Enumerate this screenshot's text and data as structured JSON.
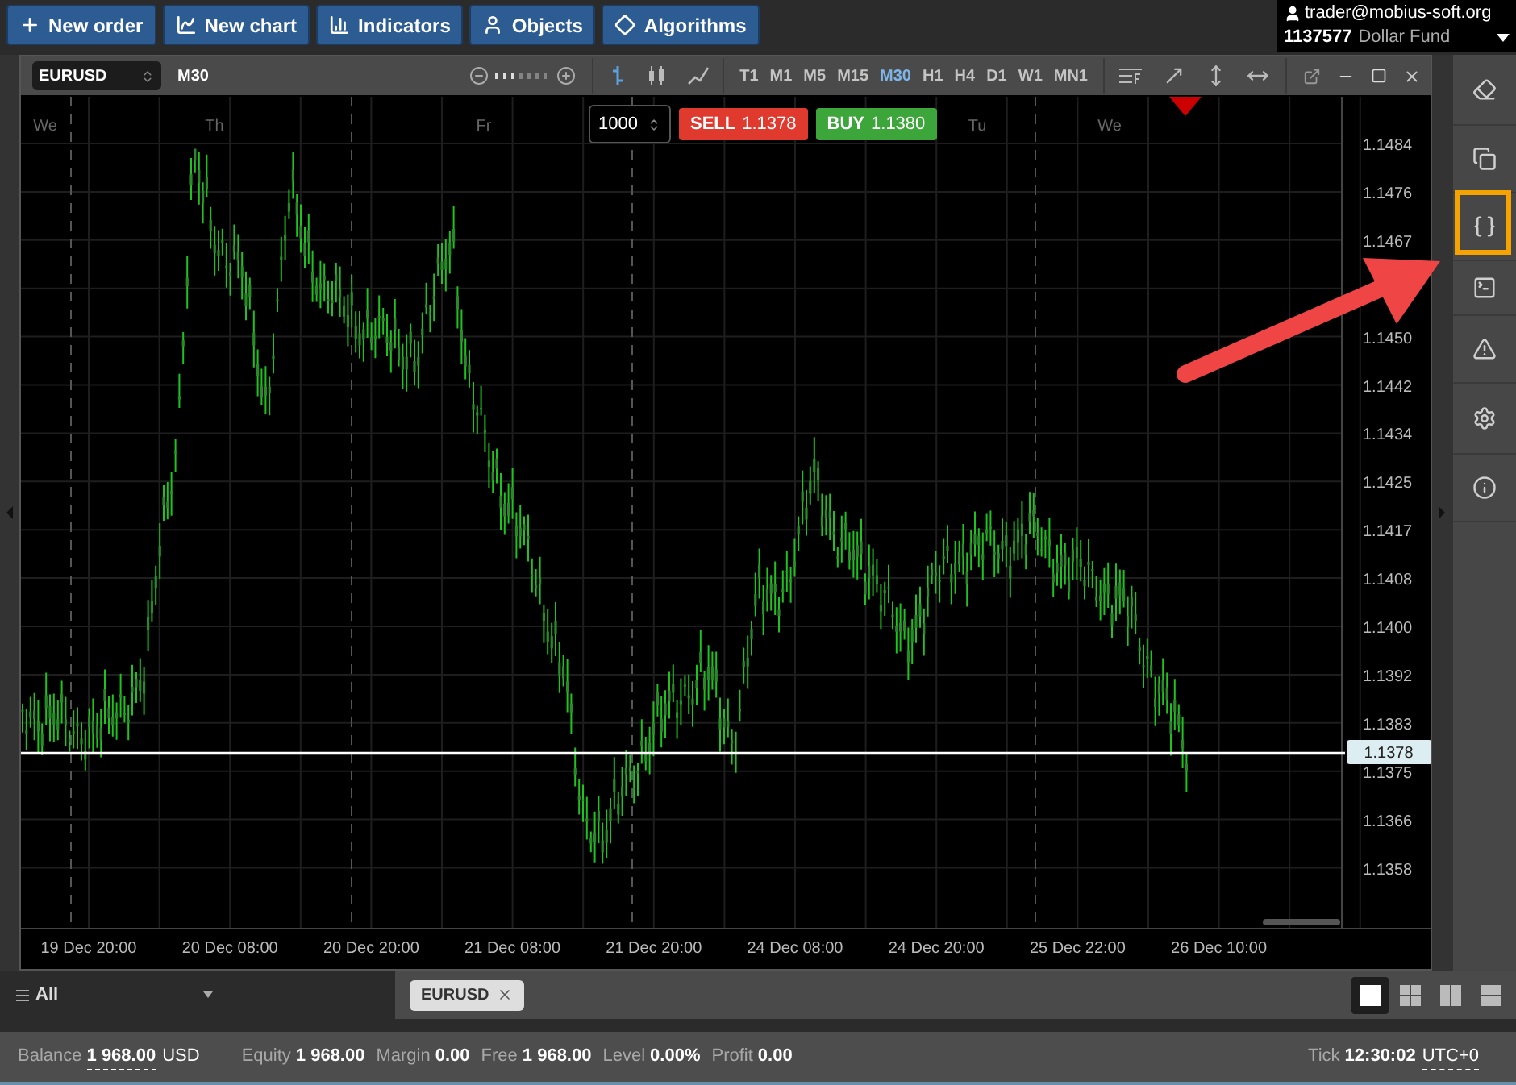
{
  "toolbar": {
    "buttons": [
      {
        "label": "New order"
      },
      {
        "label": "New chart"
      },
      {
        "label": "Indicators"
      },
      {
        "label": "Objects"
      },
      {
        "label": "Algorithms"
      }
    ]
  },
  "account": {
    "email": "trader@mobius-soft.org",
    "number": "1137577",
    "name": "Dollar Fund"
  },
  "chart_window": {
    "symbol": "EURUSD",
    "period": "M30",
    "timeframes": [
      {
        "label": "T1",
        "selected": false
      },
      {
        "label": "M1",
        "selected": false
      },
      {
        "label": "M5",
        "selected": false
      },
      {
        "label": "M15",
        "selected": false
      },
      {
        "label": "M30",
        "selected": true
      },
      {
        "label": "H1",
        "selected": false
      },
      {
        "label": "H4",
        "selected": false
      },
      {
        "label": "D1",
        "selected": false
      },
      {
        "label": "W1",
        "selected": false
      },
      {
        "label": "MN1",
        "selected": false
      }
    ],
    "quantity": "1000",
    "sell_label": "SELL",
    "sell_price": "1.1378",
    "buy_label": "BUY",
    "buy_price": "1.1380",
    "day_labels": [
      "We",
      "Th",
      "Fr",
      "Tu",
      "We"
    ],
    "price_ticks": [
      "1.1484",
      "1.1476",
      "1.1467",
      "1.1450",
      "1.1442",
      "1.1434",
      "1.1425",
      "1.1417",
      "1.1408",
      "1.1400",
      "1.1392",
      "1.1383",
      "1.1375",
      "1.1366",
      "1.1358"
    ],
    "time_ticks": [
      "19 Dec 20:00",
      "20 Dec 08:00",
      "20 Dec 20:00",
      "21 Dec 08:00",
      "21 Dec 20:00",
      "24 Dec 08:00",
      "24 Dec 20:00",
      "25 Dec 22:00",
      "26 Dec 10:00"
    ],
    "current_price": "1.1378"
  },
  "bottom_bar": {
    "filter": "All",
    "tabs": [
      {
        "label": "EURUSD"
      }
    ],
    "layouts": [
      {
        "selected": true
      },
      {
        "selected": false
      },
      {
        "selected": false
      },
      {
        "selected": false
      }
    ]
  },
  "status_bar": {
    "balance_label": "Balance",
    "balance": "1 968.00",
    "currency": "USD",
    "items": [
      {
        "label": "Equity",
        "value": "1 968.00"
      },
      {
        "label": "Margin",
        "value": "0.00"
      },
      {
        "label": "Free",
        "value": "1 968.00"
      },
      {
        "label": "Level",
        "value": "0.00%"
      },
      {
        "label": "Profit",
        "value": "0.00"
      }
    ],
    "tick_label": "Tick",
    "tick": "12:30:02",
    "timezone": "UTC+0"
  }
}
